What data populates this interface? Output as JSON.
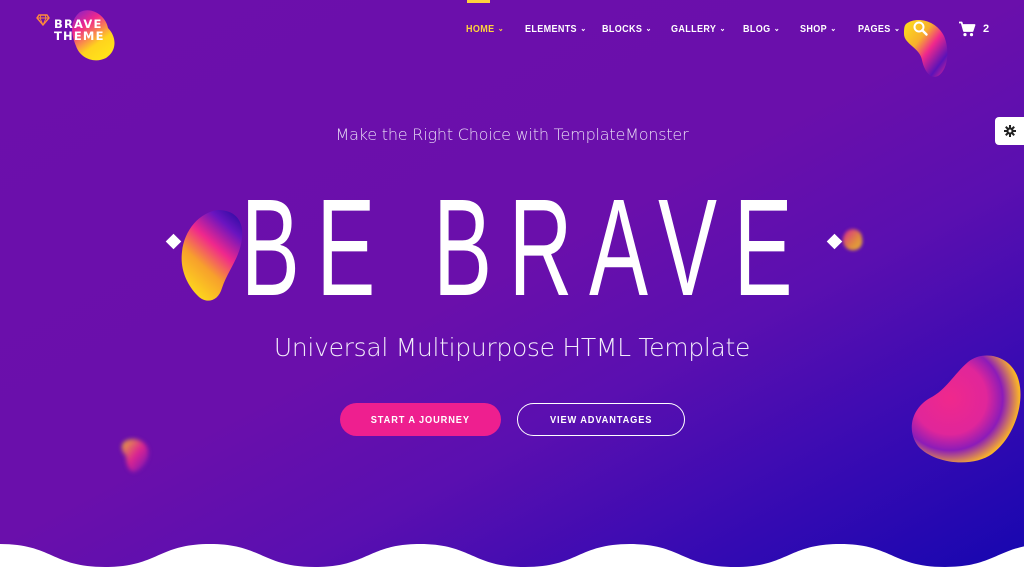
{
  "brand": {
    "line1": "BRAVE",
    "line2": "THEME",
    "icon": "diamond-gem-icon"
  },
  "nav": {
    "items": [
      {
        "label": "HOME",
        "active": true,
        "dropdown": true
      },
      {
        "label": "ELEMENTS",
        "active": false,
        "dropdown": true
      },
      {
        "label": "BLOCKS",
        "active": false,
        "dropdown": true
      },
      {
        "label": "GALLERY",
        "active": false,
        "dropdown": true
      },
      {
        "label": "BLOG",
        "active": false,
        "dropdown": true
      },
      {
        "label": "SHOP",
        "active": false,
        "dropdown": true
      },
      {
        "label": "PAGES",
        "active": false,
        "dropdown": true
      }
    ],
    "chevron": "⌄",
    "search_icon": "search-icon",
    "cart_icon": "cart-icon",
    "cart_count": "2"
  },
  "settings": {
    "icon": "gear-icon"
  },
  "hero": {
    "tagline": "Make the Right Choice with TemplateMonster",
    "title": "BE BRAVE",
    "subtitle": "Universal Multipurpose HTML Template",
    "primary_button": "START A JOURNEY",
    "secondary_button": "VIEW ADVANTAGES"
  },
  "colors": {
    "accent_yellow": "#ffd23c",
    "accent_pink": "#ee1f8f",
    "bg_purple": "#6c0fab",
    "bg_blue": "#1406b0"
  }
}
